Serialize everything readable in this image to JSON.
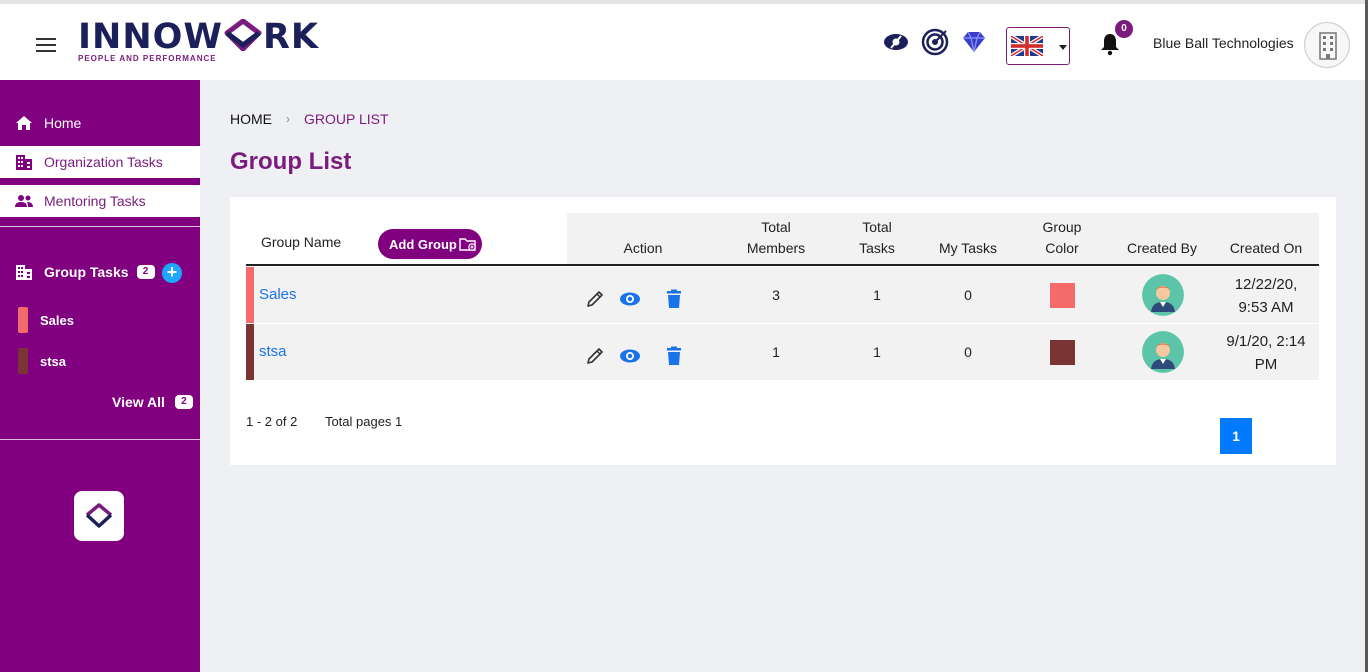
{
  "header": {
    "logo_text_a": "INNOW",
    "logo_text_b": "RK",
    "logo_tagline": "PEOPLE AND PERFORMANCE",
    "notification_count": "0",
    "company_name": "Blue Ball Technologies",
    "icons": [
      "eye-icon",
      "target-icon",
      "diamond-icon",
      "uk-flag-icon",
      "bell-icon"
    ]
  },
  "sidebar": {
    "items": [
      {
        "label": "Home",
        "icon": "home-icon"
      },
      {
        "label": "Organization Tasks",
        "icon": "building-icon"
      },
      {
        "label": "Mentoring Tasks",
        "icon": "people-icon"
      }
    ],
    "group_tasks": {
      "label": "Group Tasks",
      "count": "2"
    },
    "groups": [
      {
        "label": "Sales",
        "color": "#f56a6a"
      },
      {
        "label": "stsa",
        "color": "#7a3434"
      }
    ],
    "view_all": {
      "label": "View All",
      "count": "2"
    }
  },
  "breadcrumb": {
    "home": "HOME",
    "current": "GROUP LIST"
  },
  "page_title": "Group List",
  "table": {
    "add_group_label": "Add Group",
    "headers": {
      "group_name": "Group Name",
      "action": "Action",
      "total_members_1": "Total",
      "total_members_2": "Members",
      "total_tasks_1": "Total",
      "total_tasks_2": "Tasks",
      "my_tasks": "My Tasks",
      "group_color_1": "Group",
      "group_color_2": "Color",
      "created_by": "Created By",
      "created_on": "Created On"
    },
    "rows": [
      {
        "name": "Sales",
        "total_members": "3",
        "total_tasks": "1",
        "my_tasks": "0",
        "color": "#f56a6a",
        "created_on_1": "12/22/20,",
        "created_on_2": "9:53 AM"
      },
      {
        "name": "stsa",
        "total_members": "1",
        "total_tasks": "1",
        "my_tasks": "0",
        "color": "#7a3434",
        "created_on_1": "9/1/20, 2:14",
        "created_on_2": "PM"
      }
    ]
  },
  "pagination": {
    "range": "1 - 2 of 2",
    "total_pages": "Total pages 1",
    "current_page": "1"
  },
  "colors": {
    "brand_purple": "#800080",
    "link_blue": "#1a73e8",
    "page_blue": "#007bff"
  }
}
